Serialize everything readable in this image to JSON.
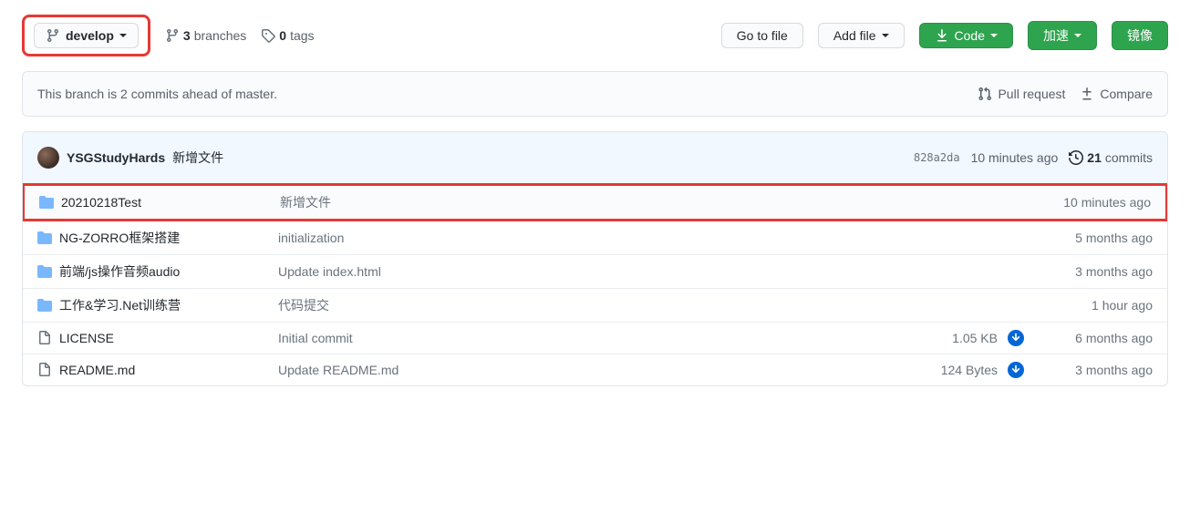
{
  "toolbar": {
    "branch": "develop",
    "branches_count": "3",
    "branches_label": "branches",
    "tags_count": "0",
    "tags_label": "tags",
    "go_to_file": "Go to file",
    "add_file": "Add file",
    "code": "Code",
    "accelerate": "加速",
    "mirror": "镜像"
  },
  "banner": {
    "text": "This branch is 2 commits ahead of master.",
    "pull_request": "Pull request",
    "compare": "Compare"
  },
  "commit": {
    "author": "YSGStudyHards",
    "message": "新增文件",
    "sha": "828a2da",
    "time": "10 minutes ago",
    "commits_count": "21",
    "commits_label": "commits"
  },
  "files": [
    {
      "type": "dir",
      "name": "20210218Test",
      "msg": "新增文件",
      "size": "",
      "download": false,
      "time": "10 minutes ago",
      "highlight": true
    },
    {
      "type": "dir",
      "name": "NG-ZORRO框架搭建",
      "msg": "initialization",
      "size": "",
      "download": false,
      "time": "5 months ago",
      "highlight": false
    },
    {
      "type": "dir",
      "name": "前端/js操作音频audio",
      "msg": "Update index.html",
      "size": "",
      "download": false,
      "time": "3 months ago",
      "highlight": false
    },
    {
      "type": "dir",
      "name": "工作&学习.Net训练营",
      "msg": "代码提交",
      "size": "",
      "download": false,
      "time": "1 hour ago",
      "highlight": false
    },
    {
      "type": "file",
      "name": "LICENSE",
      "msg": "Initial commit",
      "size": "1.05 KB",
      "download": true,
      "time": "6 months ago",
      "highlight": false
    },
    {
      "type": "file",
      "name": "README.md",
      "msg": "Update README.md",
      "size": "124 Bytes",
      "download": true,
      "time": "3 months ago",
      "highlight": false
    }
  ]
}
